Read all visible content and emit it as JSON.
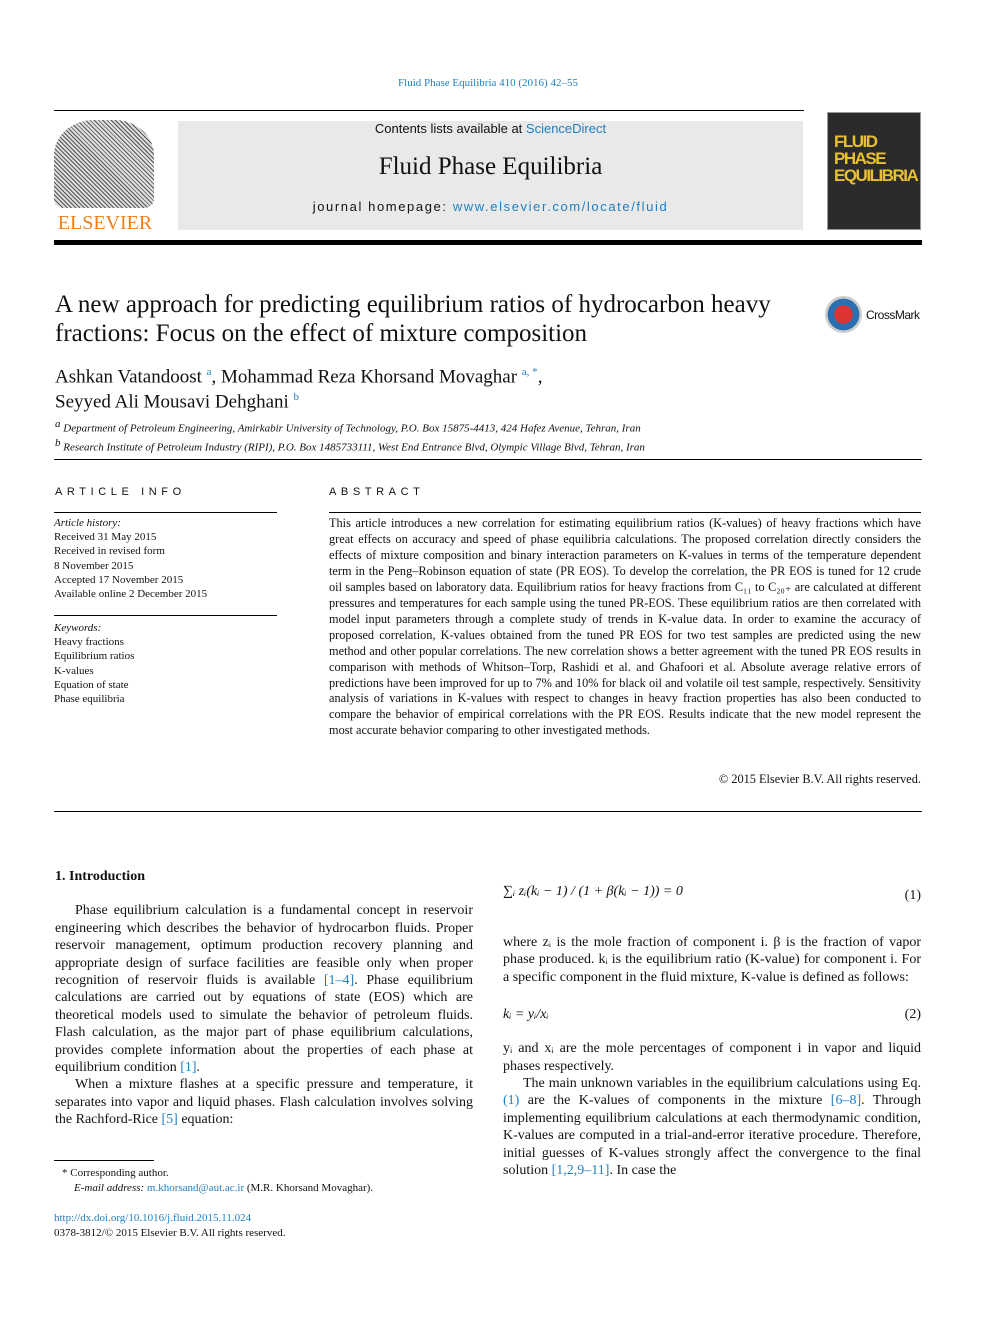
{
  "header": {
    "journal_ref": "Fluid Phase Equilibria 410 (2016) 42–55",
    "contents_prefix": "Contents lists available at ",
    "contents_link": "ScienceDirect",
    "journal_title": "Fluid Phase Equilibria",
    "homepage_prefix": "journal homepage: ",
    "homepage_link": "www.elsevier.com/locate/fluid",
    "publisher": "ELSEVIER",
    "cover_text": "FLUID PHASE EQUILIBRIA"
  },
  "article": {
    "title": "A new approach for predicting equilibrium ratios of hydrocarbon heavy fractions: Focus on the effect of mixture composition",
    "crossmark": "CrossMark",
    "authors_line1": "Ashkan Vatandoost",
    "sup1": "a",
    "authors_mid": ", Mohammad Reza Khorsand Movaghar",
    "sup2": "a, *",
    "authors_line2": "Seyyed Ali Mousavi Dehghani",
    "sup3": "b",
    "affiliations": [
      {
        "mark": "a",
        "text": "Department of Petroleum Engineering, Amirkabir University of Technology, P.O. Box 15875-4413, 424 Hafez Avenue, Tehran, Iran"
      },
      {
        "mark": "b",
        "text": "Research Institute of Petroleum Industry (RIPI), P.O. Box 1485733111, West End Entrance Blvd, Olympic Village Blvd, Tehran, Iran"
      }
    ]
  },
  "article_info": {
    "heading": "ARTICLE INFO",
    "history_label": "Article history:",
    "history": [
      "Received 31 May 2015",
      "Received in revised form",
      "8 November 2015",
      "Accepted 17 November 2015",
      "Available online 2 December 2015"
    ],
    "keywords_label": "Keywords:",
    "keywords": [
      "Heavy fractions",
      "Equilibrium ratios",
      "K-values",
      "Equation of state",
      "Phase equilibria"
    ]
  },
  "abstract": {
    "heading": "ABSTRACT",
    "text": "This article introduces a new correlation for estimating equilibrium ratios (K-values) of heavy fractions which have great effects on accuracy and speed of phase equilibria calculations. The proposed correlation directly considers the effects of mixture composition and binary interaction parameters on K-values in terms of the temperature dependent term in the Peng–Robinson equation of state (PR EOS). To develop the correlation, the PR EOS is tuned for 12 crude oil samples based on laboratory data. Equilibrium ratios for heavy fractions from C₁₁ to C₂₀₊ are calculated at different pressures and temperatures for each sample using the tuned PR-EOS. These equilibrium ratios are then correlated with model input parameters through a complete study of trends in K-value data. In order to examine the accuracy of proposed correlation, K-values obtained from the tuned PR EOS for two test samples are predicted using the new method and other popular correlations. The new correlation shows a better agreement with the tuned PR EOS results in comparison with methods of Whitson–Torp, Rashidi et al. and Ghafoori et al. Absolute average relative errors of predictions have been improved for up to 7% and 10% for black oil and volatile oil test sample, respectively. Sensitivity analysis of variations in K-values with respect to changes in heavy fraction properties has also been conducted to compare the behavior of empirical correlations with the PR EOS. Results indicate that the new model represent the most accurate behavior comparing to other investigated methods.",
    "copyright": "© 2015 Elsevier B.V. All rights reserved."
  },
  "intro": {
    "heading": "1.  Introduction",
    "p1a": "Phase equilibrium calculation is a fundamental concept in reservoir engineering which describes the behavior of hydrocarbon fluids. Proper reservoir management, optimum production recovery planning and appropriate design of surface facilities are feasible only when proper recognition of reservoir fluids is available ",
    "ref1": "[1–4]",
    "p1b": ". Phase equilibrium calculations are carried out by equations of state (EOS) which are theoretical models used to simulate the behavior of petroleum fluids. Flash calculation, as the major part of phase equilibrium calculations, provides complete information about the properties of each phase at equilibrium condition ",
    "ref2": "[1]",
    "p1c": ".",
    "p2a": "When a mixture flashes at a specific pressure and temperature, it separates into vapor and liquid phases. Flash calculation involves solving the Rachford-Rice ",
    "ref3": "[5]",
    "p2b": " equation:"
  },
  "right": {
    "eq1": "∑ᵢ zᵢ(kᵢ − 1) / (1 + β(kᵢ − 1)) = 0",
    "eq1_num": "(1)",
    "p1": "where zᵢ is the mole fraction of component i. β is the fraction of vapor phase produced. kᵢ is the equilibrium ratio (K-value) for component i. For a specific component in the fluid mixture, K-value is defined as follows:",
    "eq2": "kᵢ = yᵢ/xᵢ",
    "eq2_num": "(2)",
    "p2": "yᵢ and xᵢ are the mole percentages of component i in vapor and liquid phases respectively.",
    "p3a": "The main unknown variables in the equilibrium calculations using Eq. ",
    "ref4": "(1)",
    "p3b": " are the K-values of components in the mixture ",
    "ref5": "[6–8]",
    "p3c": ". Through implementing equilibrium calculations at each thermodynamic condition, K-values are computed in a trial-and-error iterative procedure. Therefore, initial guesses of K-values strongly affect the convergence to the final solution ",
    "ref6": "[1,2,9–11]",
    "p3d": ". In case the"
  },
  "footnote": {
    "corresponding": "* Corresponding author.",
    "email_label": "E-mail address: ",
    "email": "m.khorsand@aut.ac.ir",
    "email_suffix": " (M.R. Khorsand Movaghar).",
    "doi": "http://dx.doi.org/10.1016/j.fluid.2015.11.024",
    "issn": "0378-3812/© 2015 Elsevier B.V. All rights reserved."
  },
  "colors": {
    "link": "#1f7fc0",
    "elsevier_orange": "#f07f1a",
    "band": "#e9e9e9"
  }
}
